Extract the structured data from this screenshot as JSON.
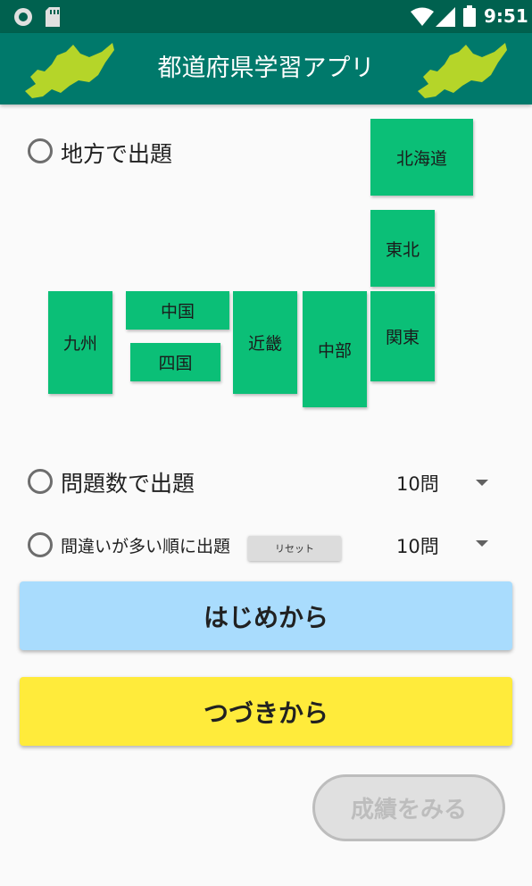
{
  "status_bar": {
    "time": "9:51"
  },
  "app_bar": {
    "title": "都道府県学習アプリ"
  },
  "region_mode": {
    "label": "地方で出題"
  },
  "regions": {
    "hokkaido": "北海道",
    "tohoku": "東北",
    "kanto": "関東",
    "chubu": "中部",
    "kinki": "近畿",
    "chugoku": "中国",
    "shikoku": "四国",
    "kyushu": "九州"
  },
  "count_mode": {
    "label": "問題数で出題",
    "selected": "10問"
  },
  "mistakes_mode": {
    "label": "間違いが多い順に出題",
    "reset_label": "リセット",
    "selected": "10問"
  },
  "buttons": {
    "start": "はじめから",
    "continue": "つづきから",
    "results": "成績をみる"
  },
  "colors": {
    "appbar": "#00796b",
    "statusbar": "#00614f",
    "region": "#0bbf77",
    "start": "#a9dcfd",
    "continue": "#ffeb3b"
  }
}
